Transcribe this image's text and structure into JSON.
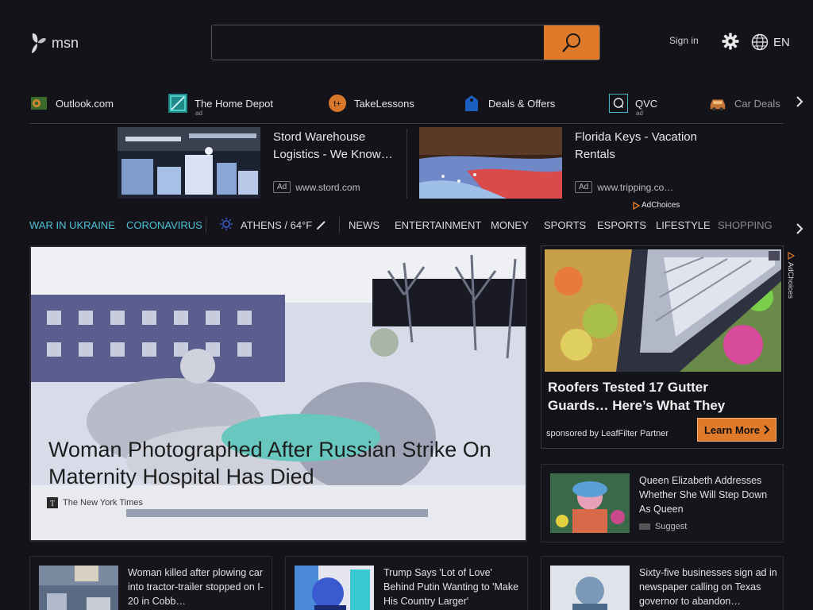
{
  "header": {
    "brand": "msn",
    "search": {
      "value": "",
      "placeholder": ""
    },
    "sign_in": "Sign in",
    "language": "EN"
  },
  "quick_links": [
    {
      "label": "Outlook.com",
      "icon": "outlook-icon",
      "ad": ""
    },
    {
      "label": "The Home Depot",
      "icon": "home-depot-icon",
      "ad": "ad"
    },
    {
      "label": "TakeLessons",
      "icon": "takelessons-icon",
      "ad": ""
    },
    {
      "label": "Deals & Offers",
      "icon": "deals-tag-icon",
      "ad": ""
    },
    {
      "label": "QVC",
      "icon": "qvc-icon",
      "ad": "ad"
    },
    {
      "label": "Car Deals",
      "icon": "car-icon",
      "ad": ""
    }
  ],
  "top_ads": [
    {
      "title": "Stord Warehouse Logistics - We Know…",
      "badge": "Ad",
      "domain": "www.stord.com"
    },
    {
      "title": "Florida Keys - Vacation Rentals",
      "badge": "Ad",
      "domain": "www.tripping.co…"
    }
  ],
  "adchoices": "AdChoices",
  "nav": {
    "highlights": [
      "WAR IN UKRAINE",
      "CORONAVIRUS"
    ],
    "weather": "ATHENS / 64°F",
    "items": [
      "NEWS",
      "ENTERTAINMENT",
      "MONEY",
      "SPORTS",
      "ESPORTS",
      "LIFESTYLE",
      "SHOPPING"
    ]
  },
  "hero": {
    "title": "Woman Photographed After Russian Strike On Maternity Hospital Has Died",
    "source": "The New York Times"
  },
  "right_ad": {
    "title": "Roofers Tested 17 Gutter Guards… Here’s What They",
    "sponsor": "sponsored by LeafFilter Partner",
    "cta": "Learn More"
  },
  "cards": [
    {
      "title": "Queen Elizabeth Addresses Whether She Will Step Down As Queen",
      "source": "Suggest"
    },
    {
      "title": "Woman killed after plowing car into tractor-trailer stopped on I-20 in Cobb…",
      "source": ""
    },
    {
      "title": "Trump Says 'Lot of Love' Behind Putin Wanting to 'Make His Country Larger'",
      "source": ""
    },
    {
      "title": "Sixty-five businesses sign ad in newspaper calling on Texas governor to abandon…",
      "source": ""
    }
  ],
  "colors": {
    "accent": "#e07a2b",
    "nav_highlight": "#4cc3d6",
    "background": "#15131a"
  }
}
